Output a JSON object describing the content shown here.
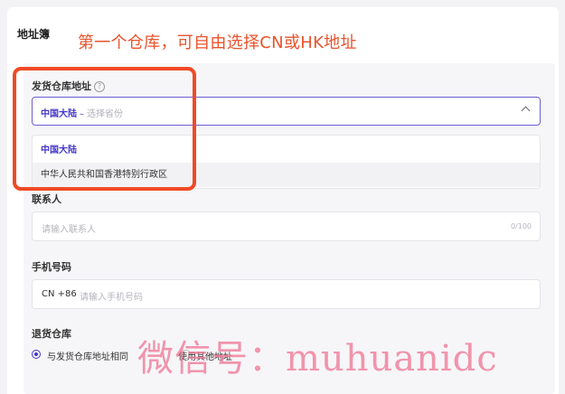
{
  "section": {
    "title": "地址簿"
  },
  "annotation": {
    "title": "第一个仓库，可自由选择CN或HK地址"
  },
  "ship_from": {
    "label": "发货仓库地址",
    "help_icon": "?",
    "selected_value": "中国大陆",
    "separator": "–",
    "placeholder": "选择省份",
    "options": [
      "中国大陆",
      "中华人民共和国香港特别行政区"
    ]
  },
  "contact": {
    "label": "联系人",
    "placeholder": "请输入联系人",
    "counter": "0/100"
  },
  "phone": {
    "label": "手机号码",
    "prefix": "CN +86",
    "placeholder": "请输入手机号码"
  },
  "return_warehouse": {
    "label": "退货仓库",
    "options": [
      "与发货仓库地址相同",
      "使用其他地址"
    ],
    "selected_index": 0
  },
  "watermark": {
    "text": "微信号：muhuanidc"
  },
  "colors": {
    "accent": "#4537c8",
    "annotation": "#e8532c",
    "highlight": "#f04a24"
  }
}
